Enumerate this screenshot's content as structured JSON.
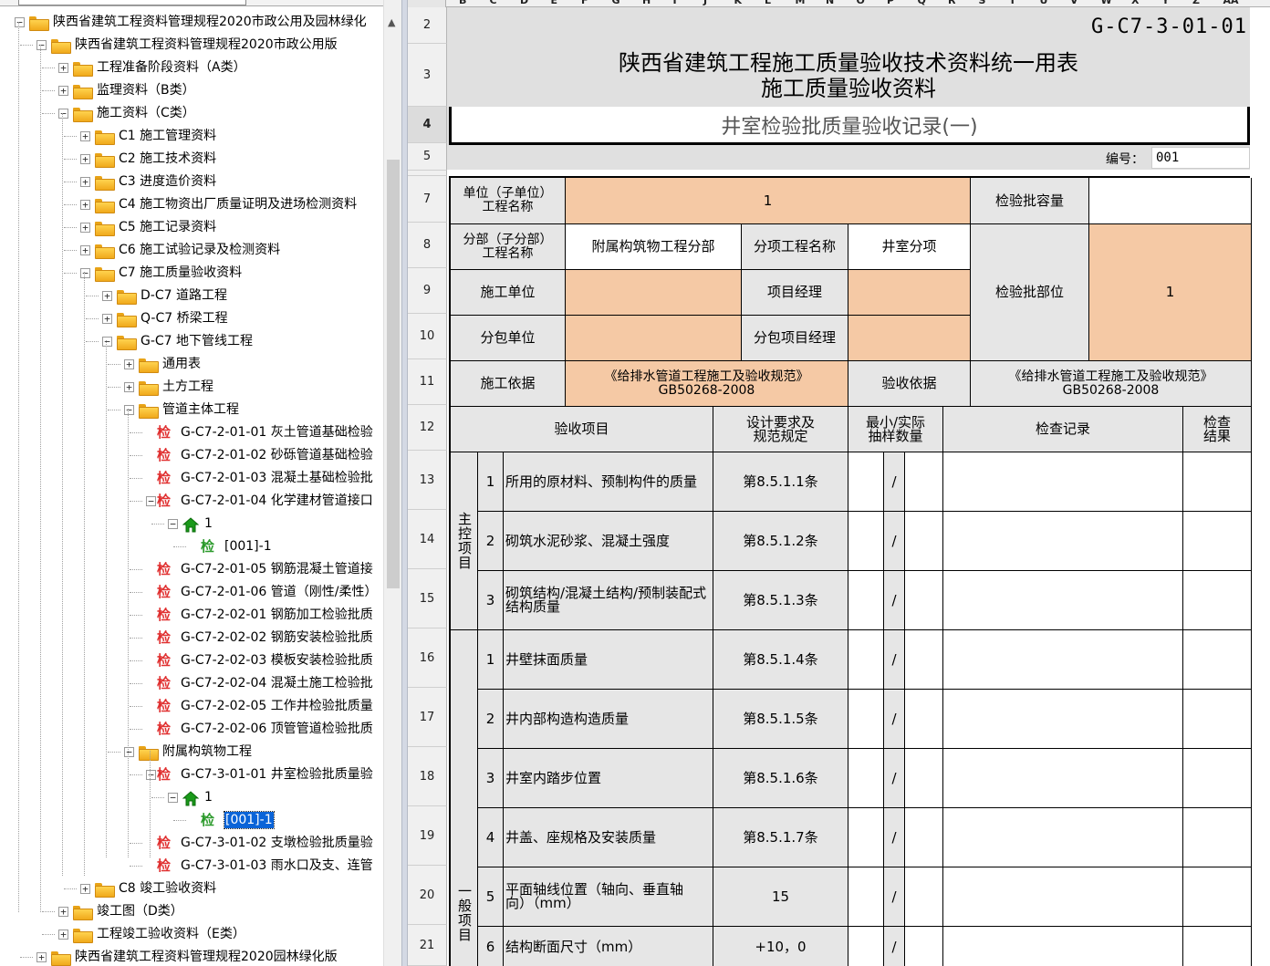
{
  "tree": {
    "nodes": [
      {
        "label": "陕西省建筑工程资料管理规程2020市政公用及园林绿化",
        "type": "folder",
        "exp": "-"
      },
      {
        "label": "陕西省建筑工程资料管理规程2020市政公用版",
        "type": "folder",
        "exp": "-"
      },
      {
        "label": "工程准备阶段资料（A类）",
        "type": "folder",
        "exp": "+"
      },
      {
        "label": "监理资料（B类）",
        "type": "folder",
        "exp": "+"
      },
      {
        "label": "施工资料（C类）",
        "type": "folder",
        "exp": "-"
      },
      {
        "label": "C1 施工管理资料",
        "type": "folder",
        "exp": "+"
      },
      {
        "label": "C2 施工技术资料",
        "type": "folder",
        "exp": "+"
      },
      {
        "label": "C3 进度造价资料",
        "type": "folder",
        "exp": "+"
      },
      {
        "label": "C4 施工物资出厂质量证明及进场检测资料",
        "type": "folder",
        "exp": "+"
      },
      {
        "label": "C5 施工记录资料",
        "type": "folder",
        "exp": "+"
      },
      {
        "label": "C6 施工试验记录及检测资料",
        "type": "folder",
        "exp": "+"
      },
      {
        "label": "C7 施工质量验收资料",
        "type": "folder",
        "exp": "-"
      },
      {
        "label": "D-C7 道路工程",
        "type": "folder",
        "exp": "+"
      },
      {
        "label": "Q-C7 桥梁工程",
        "type": "folder",
        "exp": "+"
      },
      {
        "label": "G-C7 地下管线工程",
        "type": "folder",
        "exp": "-"
      },
      {
        "label": "通用表",
        "type": "folder",
        "exp": "+"
      },
      {
        "label": "土方工程",
        "type": "folder",
        "exp": "+"
      },
      {
        "label": "管道主体工程",
        "type": "folder",
        "exp": "-"
      },
      {
        "label": "G-C7-2-01-01 灰土管道基础检验",
        "type": "doc",
        "exp": ""
      },
      {
        "label": "G-C7-2-01-02 砂砾管道基础检验",
        "type": "doc",
        "exp": ""
      },
      {
        "label": "G-C7-2-01-03 混凝土基础检验批",
        "type": "doc",
        "exp": ""
      },
      {
        "label": "G-C7-2-01-04 化学建材管道接口",
        "type": "doc",
        "exp": "-"
      },
      {
        "label": "1",
        "type": "home",
        "exp": "-"
      },
      {
        "label": "[001]-1",
        "type": "gdoc",
        "exp": ""
      },
      {
        "label": "G-C7-2-01-05 钢筋混凝土管道接",
        "type": "doc",
        "exp": ""
      },
      {
        "label": "G-C7-2-01-06 管道（刚性/柔性）",
        "type": "doc",
        "exp": ""
      },
      {
        "label": "G-C7-2-02-01 钢筋加工检验批质",
        "type": "doc",
        "exp": ""
      },
      {
        "label": "G-C7-2-02-02 钢筋安装检验批质",
        "type": "doc",
        "exp": ""
      },
      {
        "label": "G-C7-2-02-03 模板安装检验批质",
        "type": "doc",
        "exp": ""
      },
      {
        "label": "G-C7-2-02-04 混凝土施工检验批",
        "type": "doc",
        "exp": ""
      },
      {
        "label": "G-C7-2-02-05 工作井检验批质量",
        "type": "doc",
        "exp": ""
      },
      {
        "label": "G-C7-2-02-06 顶管管道检验批质",
        "type": "doc",
        "exp": ""
      },
      {
        "label": "附属构筑物工程",
        "type": "folder",
        "exp": "-"
      },
      {
        "label": "G-C7-3-01-01 井室检验批质量验",
        "type": "doc",
        "exp": "-"
      },
      {
        "label": "1",
        "type": "home",
        "exp": "-"
      },
      {
        "label": "[001]-1",
        "type": "gdoc",
        "exp": "",
        "selected": true
      },
      {
        "label": "G-C7-3-01-02 支墩检验批质量验",
        "type": "doc",
        "exp": ""
      },
      {
        "label": "G-C7-3-01-03 雨水口及支、连管",
        "type": "doc",
        "exp": ""
      },
      {
        "label": "C8 竣工验收资料",
        "type": "folder",
        "exp": "+"
      },
      {
        "label": "竣工图（D类）",
        "type": "folder",
        "exp": "+"
      },
      {
        "label": "工程竣工验收资料（E类）",
        "type": "folder",
        "exp": "+"
      },
      {
        "label": "陕西省建筑工程资料管理规程2020园林绿化版",
        "type": "folder",
        "exp": "+"
      }
    ],
    "doc_glyph": "检"
  },
  "sheet": {
    "col_letters": [
      "B",
      "C",
      "D",
      "E",
      "F",
      "G",
      "H",
      "I",
      "J",
      "K",
      "L",
      "M",
      "N",
      "O",
      "P",
      "Q",
      "R",
      "S",
      "T",
      "U",
      "V",
      "W",
      "X",
      "Y",
      "Z",
      "AA"
    ],
    "rows": [
      {
        "n": "2"
      },
      {
        "n": "3"
      },
      {
        "n": "4"
      },
      {
        "n": "5"
      },
      {
        "n": "7"
      },
      {
        "n": "8"
      },
      {
        "n": "9"
      },
      {
        "n": "10"
      },
      {
        "n": "11"
      },
      {
        "n": "12"
      },
      {
        "n": "13"
      },
      {
        "n": "14"
      },
      {
        "n": "15"
      },
      {
        "n": "16"
      },
      {
        "n": "17"
      },
      {
        "n": "18"
      },
      {
        "n": "19"
      },
      {
        "n": "20"
      },
      {
        "n": "21"
      }
    ],
    "code": "G-C7-3-01-01",
    "title1": "陕西省建筑工程施工质量验收技术资料统一用表",
    "title2": "施工质量验收资料",
    "subtitle": "井室检验批质量验收记录(一)",
    "number_label": "编号：",
    "number_value": "001",
    "labels": {
      "unit": "单位（子单位）\n工程名称",
      "unit_value": "1",
      "capacity": "检验批容量",
      "division": "分部（子分部）\n工程名称",
      "division_value": "附属构筑物工程分部",
      "item_name": "分项工程名称",
      "item_value": "井室分项",
      "batch_part": "检验批部位",
      "batch_part_value": "1",
      "contractor": "施工单位",
      "pm": "项目经理",
      "subcontractor": "分包单位",
      "sub_pm": "分包项目经理",
      "basis": "施工依据",
      "basis_value": "《给排水管道工程施工及验收规范》\nGB50268-2008",
      "accept_basis": "验收依据",
      "accept_basis_value": "《给排水管道工程施工及验收规范》\nGB50268-2008",
      "items": "验收项目",
      "design": "设计要求及\n规范规定",
      "sample": "最小/实际\n抽样数量",
      "record": "检查记录",
      "result": "检查\n结果",
      "main": "主控项目",
      "general": "一般项目"
    },
    "main_items": [
      {
        "no": "1",
        "text": "所用的原材料、预制构件的质量",
        "spec": "第8.5.1.1条",
        "slash": "/"
      },
      {
        "no": "2",
        "text": "砌筑水泥砂浆、混凝土强度",
        "spec": "第8.5.1.2条",
        "slash": "/"
      },
      {
        "no": "3",
        "text": "砌筑结构/混凝土结构/预制装配式结构质量",
        "spec": "第8.5.1.3条",
        "slash": "/"
      }
    ],
    "general_items": [
      {
        "no": "1",
        "text": "井壁抹面质量",
        "spec": "第8.5.1.4条",
        "slash": "/"
      },
      {
        "no": "2",
        "text": "井内部构造构造质量",
        "spec": "第8.5.1.5条",
        "slash": "/"
      },
      {
        "no": "3",
        "text": "井室内踏步位置",
        "spec": "第8.5.1.6条",
        "slash": "/"
      },
      {
        "no": "4",
        "text": "井盖、座规格及安装质量",
        "spec": "第8.5.1.7条",
        "slash": "/"
      },
      {
        "no": "5",
        "text": "平面轴线位置（轴向、垂直轴向）（mm）",
        "spec": "15",
        "slash": "/"
      },
      {
        "no": "6",
        "text": "结构断面尺寸（mm）",
        "spec": "+10，0",
        "slash": "/"
      }
    ]
  }
}
